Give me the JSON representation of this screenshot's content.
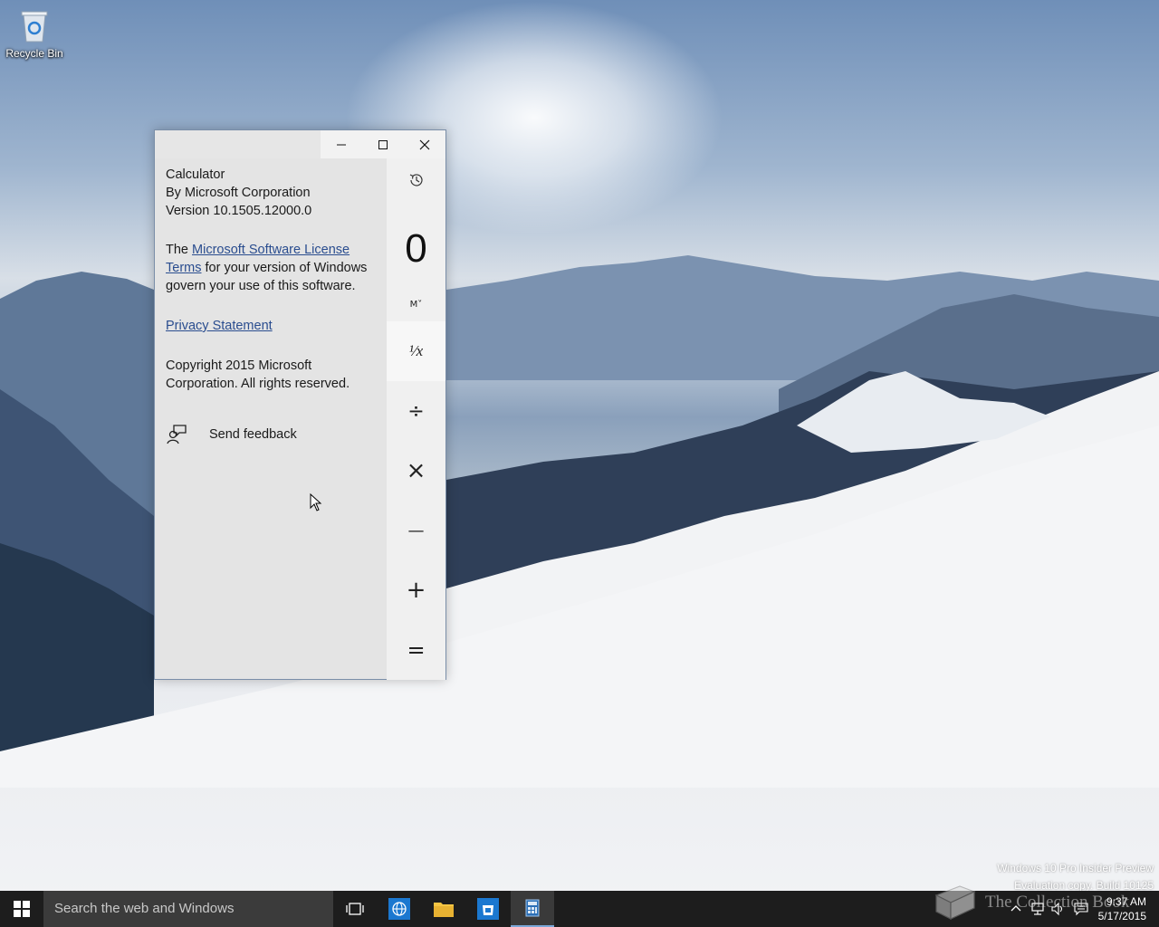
{
  "desktop": {
    "icons": [
      {
        "label": "Recycle Bin",
        "icon": "recycle-bin-icon"
      }
    ]
  },
  "window": {
    "controls": {
      "minimize": "–",
      "maximize": "☐",
      "close": "✕"
    },
    "about": {
      "app_name": "Calculator",
      "publisher": "By Microsoft Corporation",
      "version": "Version 10.1505.12000.0",
      "license_prefix": "The ",
      "license_link_1": "Microsoft Software License",
      "license_link_2": "Terms",
      "license_suffix_1": " for your version of Windows",
      "license_suffix_2": "govern your use of this software.",
      "privacy_link": "Privacy Statement",
      "copyright_1": "Copyright 2015 Microsoft",
      "copyright_2": "Corporation. All rights reserved.",
      "feedback_label": "Send feedback"
    },
    "calc": {
      "display": "0",
      "memory_label": "M˅",
      "reciprocal": "¹⁄x",
      "divide": "÷",
      "multiply": "×",
      "minus": "—",
      "plus": "+",
      "equals": "="
    }
  },
  "watermark": {
    "line1": "Windows 10 Pro Insider Preview",
    "line2": "Evaluation copy. Build 10125"
  },
  "taskbar": {
    "search_placeholder": "Search the web and Windows",
    "clock_time": "9:37 AM",
    "clock_date": "5/17/2015",
    "brand_text": "The Collection Book"
  },
  "colors": {
    "link": "#2a4d8f",
    "taskbar": "#1d1d1d",
    "search_bg": "#3b3b3b",
    "active_underline": "#7aa7d8"
  }
}
